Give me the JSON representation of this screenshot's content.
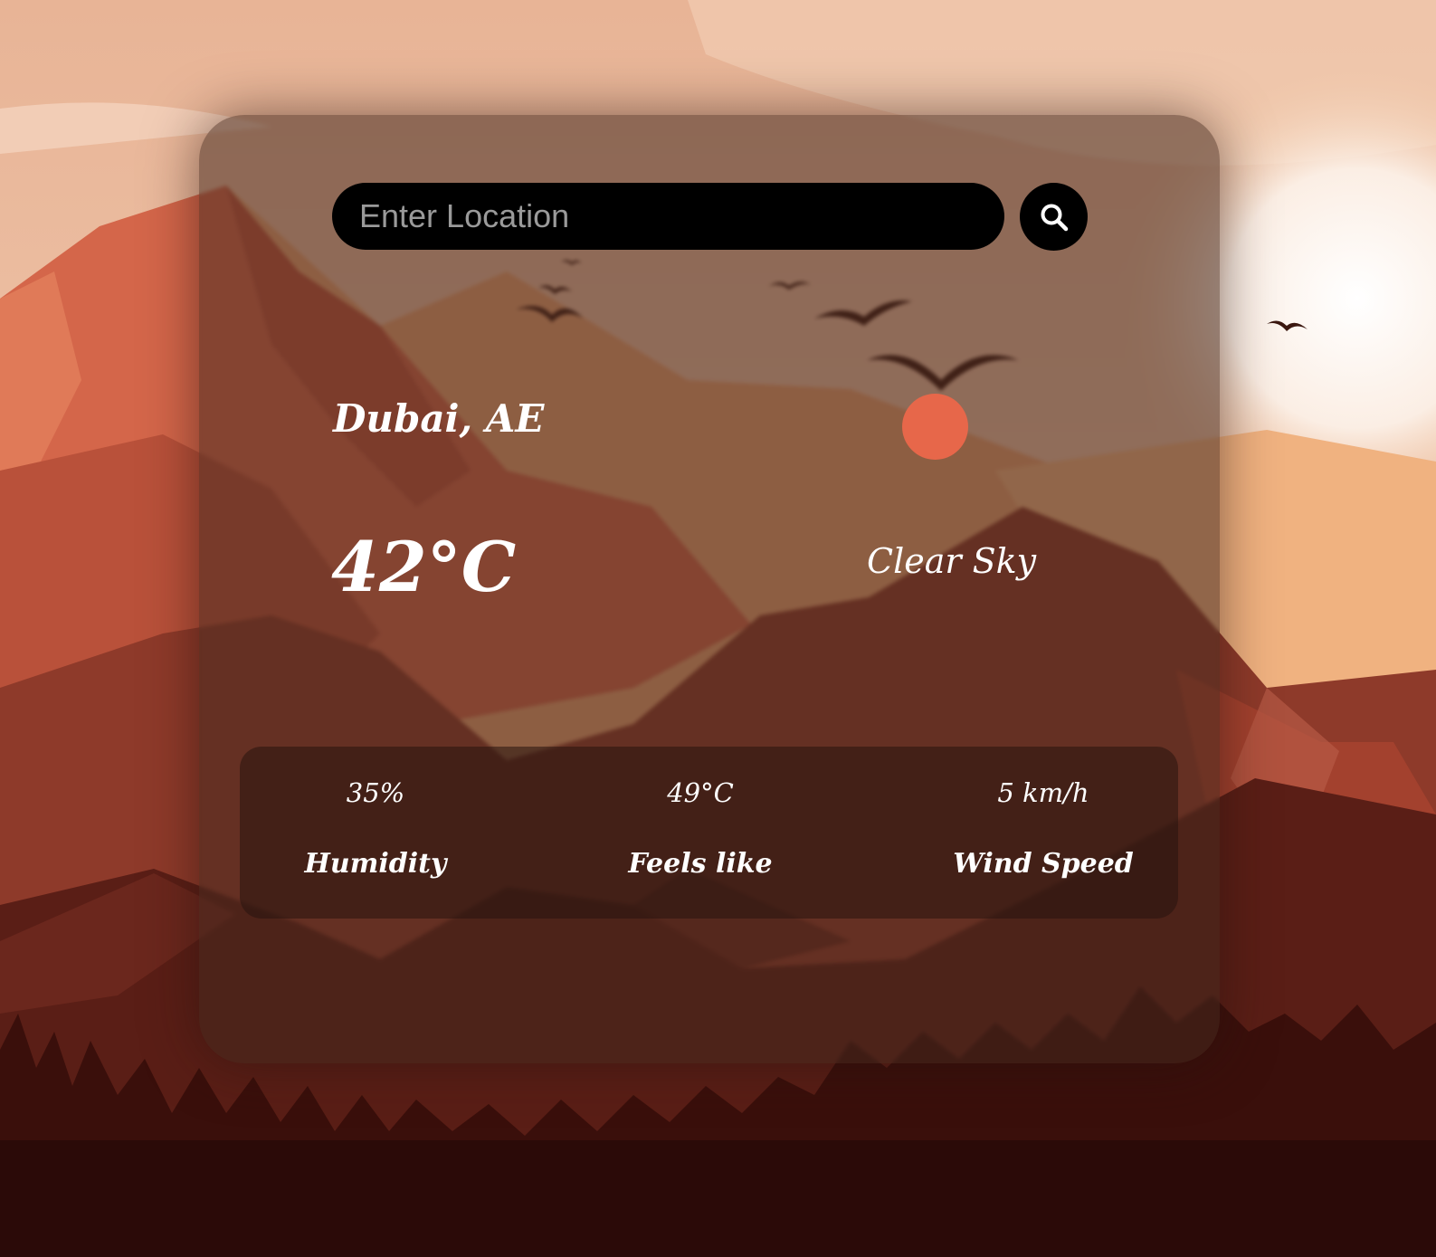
{
  "search": {
    "placeholder": "Enter Location",
    "value": "",
    "button_icon": "search-icon"
  },
  "weather": {
    "location": "Dubai, AE",
    "temperature": "42°C",
    "condition": "Clear Sky",
    "condition_icon": "sun-icon"
  },
  "stats": [
    {
      "value": "35%",
      "label": "Humidity"
    },
    {
      "value": "49°C",
      "label": "Feels like"
    },
    {
      "value": "5 km/h",
      "label": "Wind Speed"
    }
  ],
  "colors": {
    "sun": "#e7674a",
    "search_bg": "#000000",
    "text": "#ffffff"
  }
}
